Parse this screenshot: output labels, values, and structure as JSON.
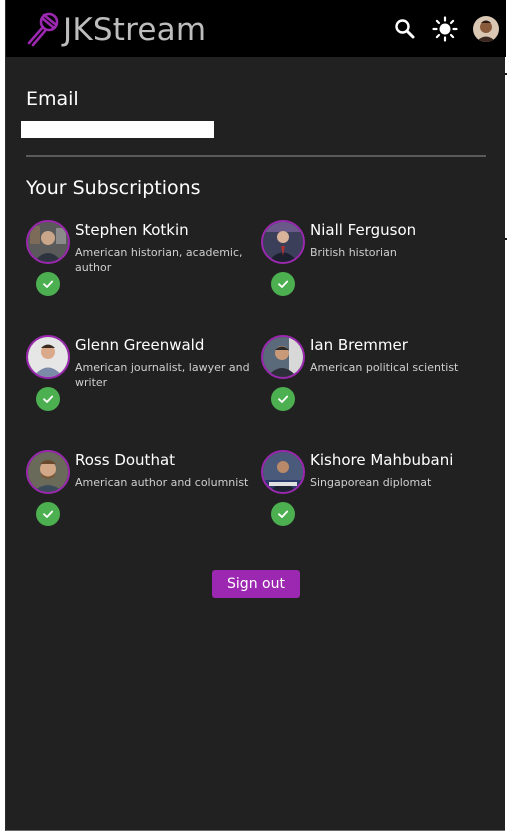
{
  "app": {
    "title": "JKStream",
    "brand_color": "#9c27b0",
    "icons": {
      "logo": "microphone-icon",
      "search": "search-icon",
      "theme": "sun-icon",
      "account": "user-avatar"
    }
  },
  "profile": {
    "email_label": "Email",
    "email_value": ""
  },
  "subscriptions": {
    "title": "Your Subscriptions",
    "check_color": "#4caf50",
    "items": [
      {
        "name": "Stephen Kotkin",
        "description": "American historian, academic, author",
        "subscribed": true
      },
      {
        "name": "Niall Ferguson",
        "description": "British historian",
        "subscribed": true
      },
      {
        "name": "Glenn Greenwald",
        "description": "American journalist, lawyer and writer",
        "subscribed": true
      },
      {
        "name": "Ian Bremmer",
        "description": "American political scientist",
        "subscribed": true
      },
      {
        "name": "Ross Douthat",
        "description": "American author and columnist",
        "subscribed": true
      },
      {
        "name": "Kishore Mahbubani",
        "description": "Singaporean diplomat",
        "subscribed": true
      }
    ]
  },
  "actions": {
    "sign_out_label": "Sign out"
  }
}
